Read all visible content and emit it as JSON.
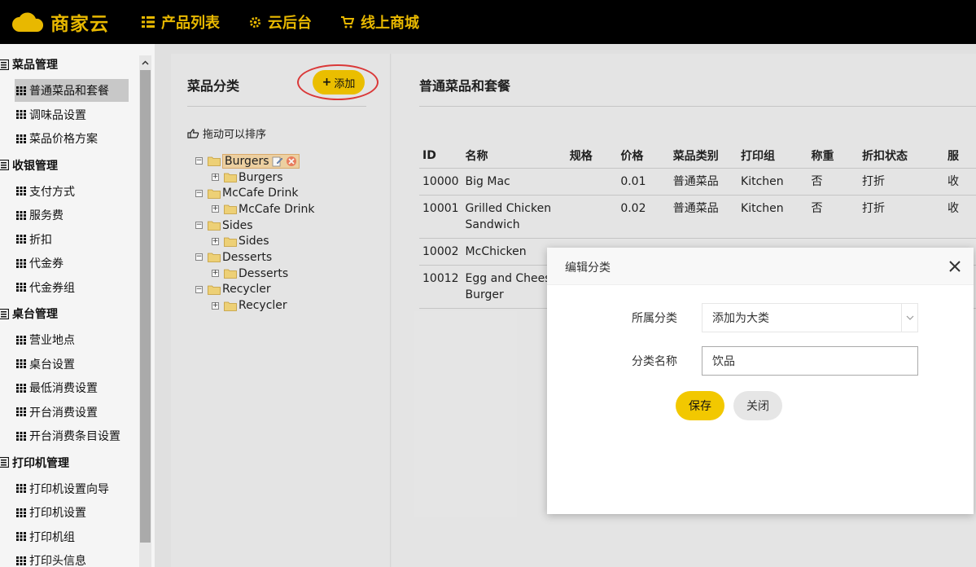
{
  "header": {
    "brand": "商家云",
    "nav": [
      {
        "label": "产品列表",
        "icon": "list-icon"
      },
      {
        "label": "云后台",
        "icon": "gear-icon"
      },
      {
        "label": "线上商城",
        "icon": "cart-icon"
      }
    ]
  },
  "sidebar": {
    "groups": [
      {
        "label": "菜品管理",
        "items": [
          "普通菜品和套餐",
          "调味品设置",
          "菜品价格方案"
        ]
      },
      {
        "label": "收银管理",
        "items": [
          "支付方式",
          "服务费",
          "折扣",
          "代金券",
          "代金券组"
        ]
      },
      {
        "label": "桌台管理",
        "items": [
          "营业地点",
          "桌台设置",
          "最低消费设置",
          "开台消费设置",
          "开台消费条目设置"
        ]
      },
      {
        "label": "打印机管理",
        "items": [
          "打印机设置向导",
          "打印机设置",
          "打印机组",
          "打印头信息"
        ]
      }
    ],
    "active_item": "普通菜品和套餐"
  },
  "category_panel": {
    "title": "菜品分类",
    "add_label": "添加",
    "drag_hint": "拖动可以排序",
    "tree": [
      {
        "label": "Burgers",
        "child": "Burgers",
        "selected": true
      },
      {
        "label": "McCafe Drink",
        "child": "McCafe Drink"
      },
      {
        "label": "Sides",
        "child": "Sides"
      },
      {
        "label": "Desserts",
        "child": "Desserts"
      },
      {
        "label": "Recycler",
        "child": "Recycler"
      }
    ]
  },
  "product_panel": {
    "title": "普通菜品和套餐",
    "columns": [
      "ID",
      "名称",
      "规格",
      "价格",
      "菜品类别",
      "打印组",
      "称重",
      "折扣状态",
      "服"
    ],
    "rows": [
      [
        "10000",
        "Big Mac",
        "",
        "0.01",
        "普通菜品",
        "Kitchen",
        "否",
        "打折",
        "收"
      ],
      [
        "10001",
        "Grilled Chicken Sandwich",
        "",
        "0.02",
        "普通菜品",
        "Kitchen",
        "否",
        "打折",
        "收"
      ],
      [
        "10002",
        "McChicken",
        "",
        "",
        "",
        "",
        "",
        "",
        ""
      ],
      [
        "10012",
        "Egg and Cheese Burger",
        "",
        "",
        "",
        "",
        "",
        "",
        ""
      ]
    ]
  },
  "modal": {
    "title": "编辑分类",
    "parent_label": "所属分类",
    "parent_value": "添加为大类",
    "name_label": "分类名称",
    "name_value": "饮品",
    "save_label": "保存",
    "close_label": "关闭"
  },
  "colors": {
    "accent": "#f2c500",
    "brand_text": "#e8b800",
    "highlight_ring": "#e23a3a"
  }
}
